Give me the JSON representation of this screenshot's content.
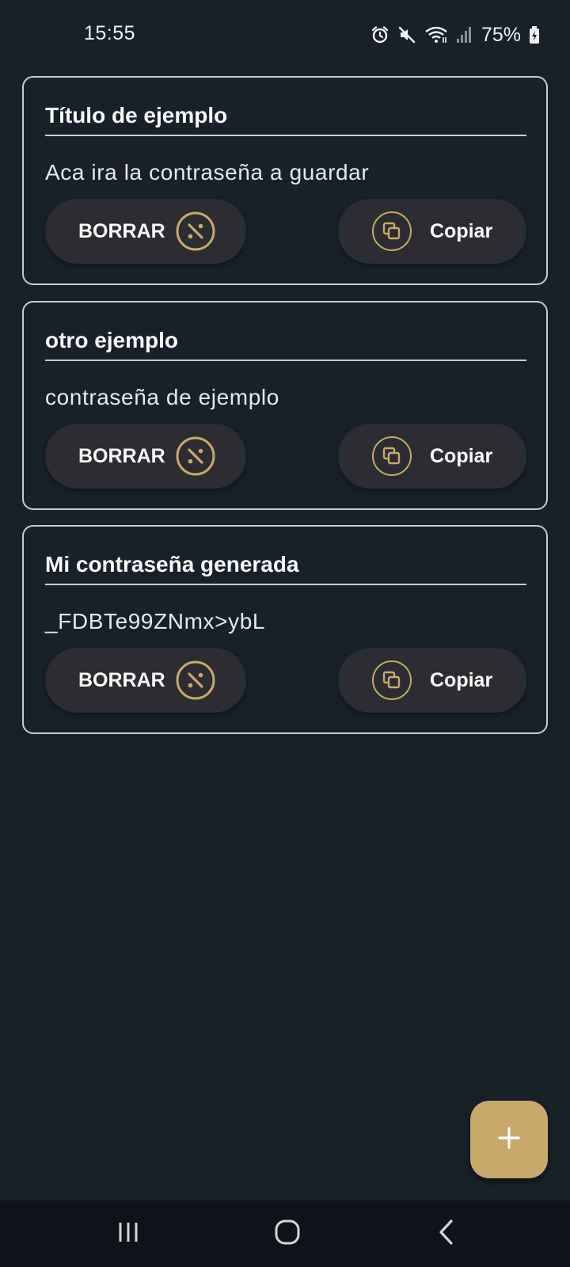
{
  "status_bar": {
    "time": "15:55",
    "battery": "75%",
    "icons": [
      "alarm-icon",
      "mute-icon",
      "wifi-icon",
      "signal-icon",
      "battery-charging-icon"
    ]
  },
  "cards": [
    {
      "title": "Título de ejemplo",
      "password": "Aca ira la contraseña a guardar",
      "delete_label": "BORRAR",
      "copy_label": "Copiar"
    },
    {
      "title": "otro ejemplo",
      "password": "contraseña de ejemplo",
      "delete_label": "BORRAR",
      "copy_label": "Copiar"
    },
    {
      "title": "Mi contraseña generada",
      "password": "_FDBTe99ZNmx>ybL",
      "delete_label": "BORRAR",
      "copy_label": "Copiar"
    }
  ],
  "fab": {
    "icon": "plus-icon"
  },
  "nav": {
    "icons": [
      "recent-apps-icon",
      "home-icon",
      "back-icon"
    ]
  },
  "colors": {
    "background": "#18202a",
    "accent": "#c8a96b",
    "button": "#2b2d31",
    "border": "#c9ccd0"
  }
}
